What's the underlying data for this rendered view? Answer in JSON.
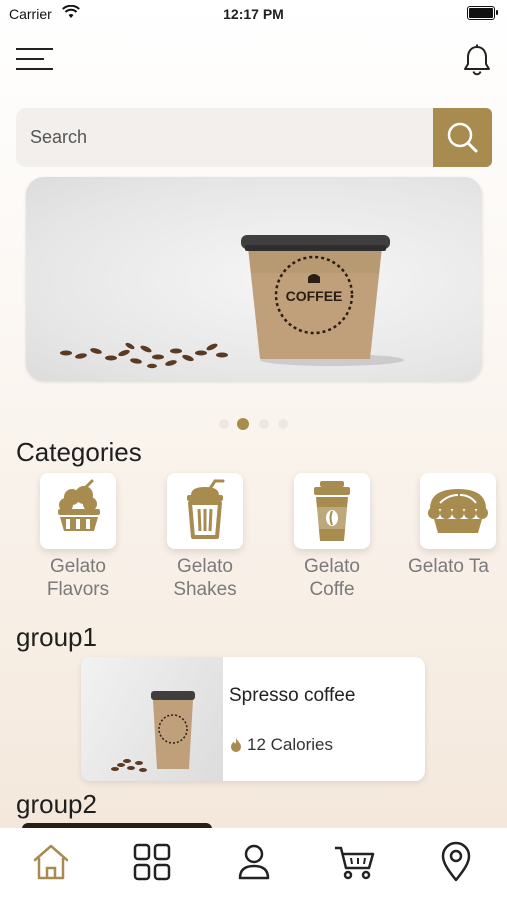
{
  "status_bar": {
    "carrier": "Carrier",
    "time": "12:17 PM"
  },
  "search": {
    "placeholder": "Search"
  },
  "carousel": {
    "page_count": 4,
    "active_index": 1
  },
  "categories": {
    "title": "Categories",
    "items": [
      {
        "label": "Gelato\nFlavors",
        "icon": "ice-cream-bowl-icon"
      },
      {
        "label": "Gelato\nShakes",
        "icon": "shake-cup-icon"
      },
      {
        "label": "Gelato\nCoffe",
        "icon": "coffee-cup-icon"
      },
      {
        "label": "Gelato Ta",
        "icon": "pie-icon"
      }
    ]
  },
  "group1": {
    "title": "group1",
    "product": {
      "name": "Spresso coffee",
      "calories": "12 Calories"
    }
  },
  "group2": {
    "title": "group2"
  },
  "banner": {
    "cup_text": "COFFEE"
  },
  "nav": [
    "home-icon",
    "grid-icon",
    "user-icon",
    "cart-icon",
    "location-icon"
  ],
  "colors": {
    "accent": "#a88b4f",
    "text": "#1f1f1f",
    "muted": "#7a7a7a"
  }
}
